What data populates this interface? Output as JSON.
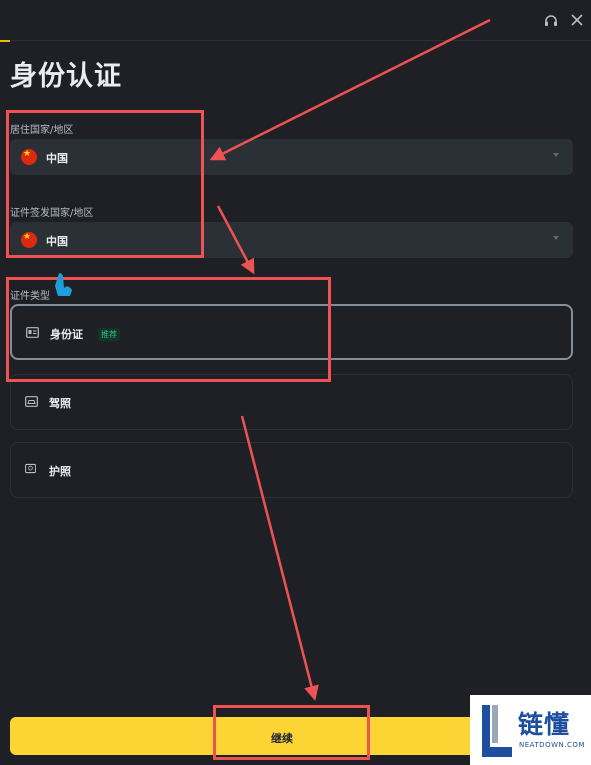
{
  "header": {
    "headset_icon": "headset-icon",
    "close_icon": "close-icon"
  },
  "page_title": "身份认证",
  "residence": {
    "label": "居住国家/地区",
    "value": "中国",
    "flag": "china-flag-icon"
  },
  "issuing": {
    "label": "证件签发国家/地区",
    "value": "中国",
    "flag": "china-flag-icon"
  },
  "doc_type": {
    "label": "证件类型",
    "options": [
      {
        "label": "身份证",
        "badge": "推荐",
        "icon": "id-card-icon",
        "selected": true
      },
      {
        "label": "驾照",
        "icon": "driver-license-icon",
        "selected": false
      },
      {
        "label": "护照",
        "icon": "passport-icon",
        "selected": false
      }
    ]
  },
  "continue_label": "继续",
  "watermark": {
    "text": "链懂",
    "sub": "NEATDOWN.COM"
  },
  "colors": {
    "background": "#1e2026",
    "accent": "#fcd535",
    "annotation": "#ee5253",
    "badge": "#2ebd85"
  }
}
